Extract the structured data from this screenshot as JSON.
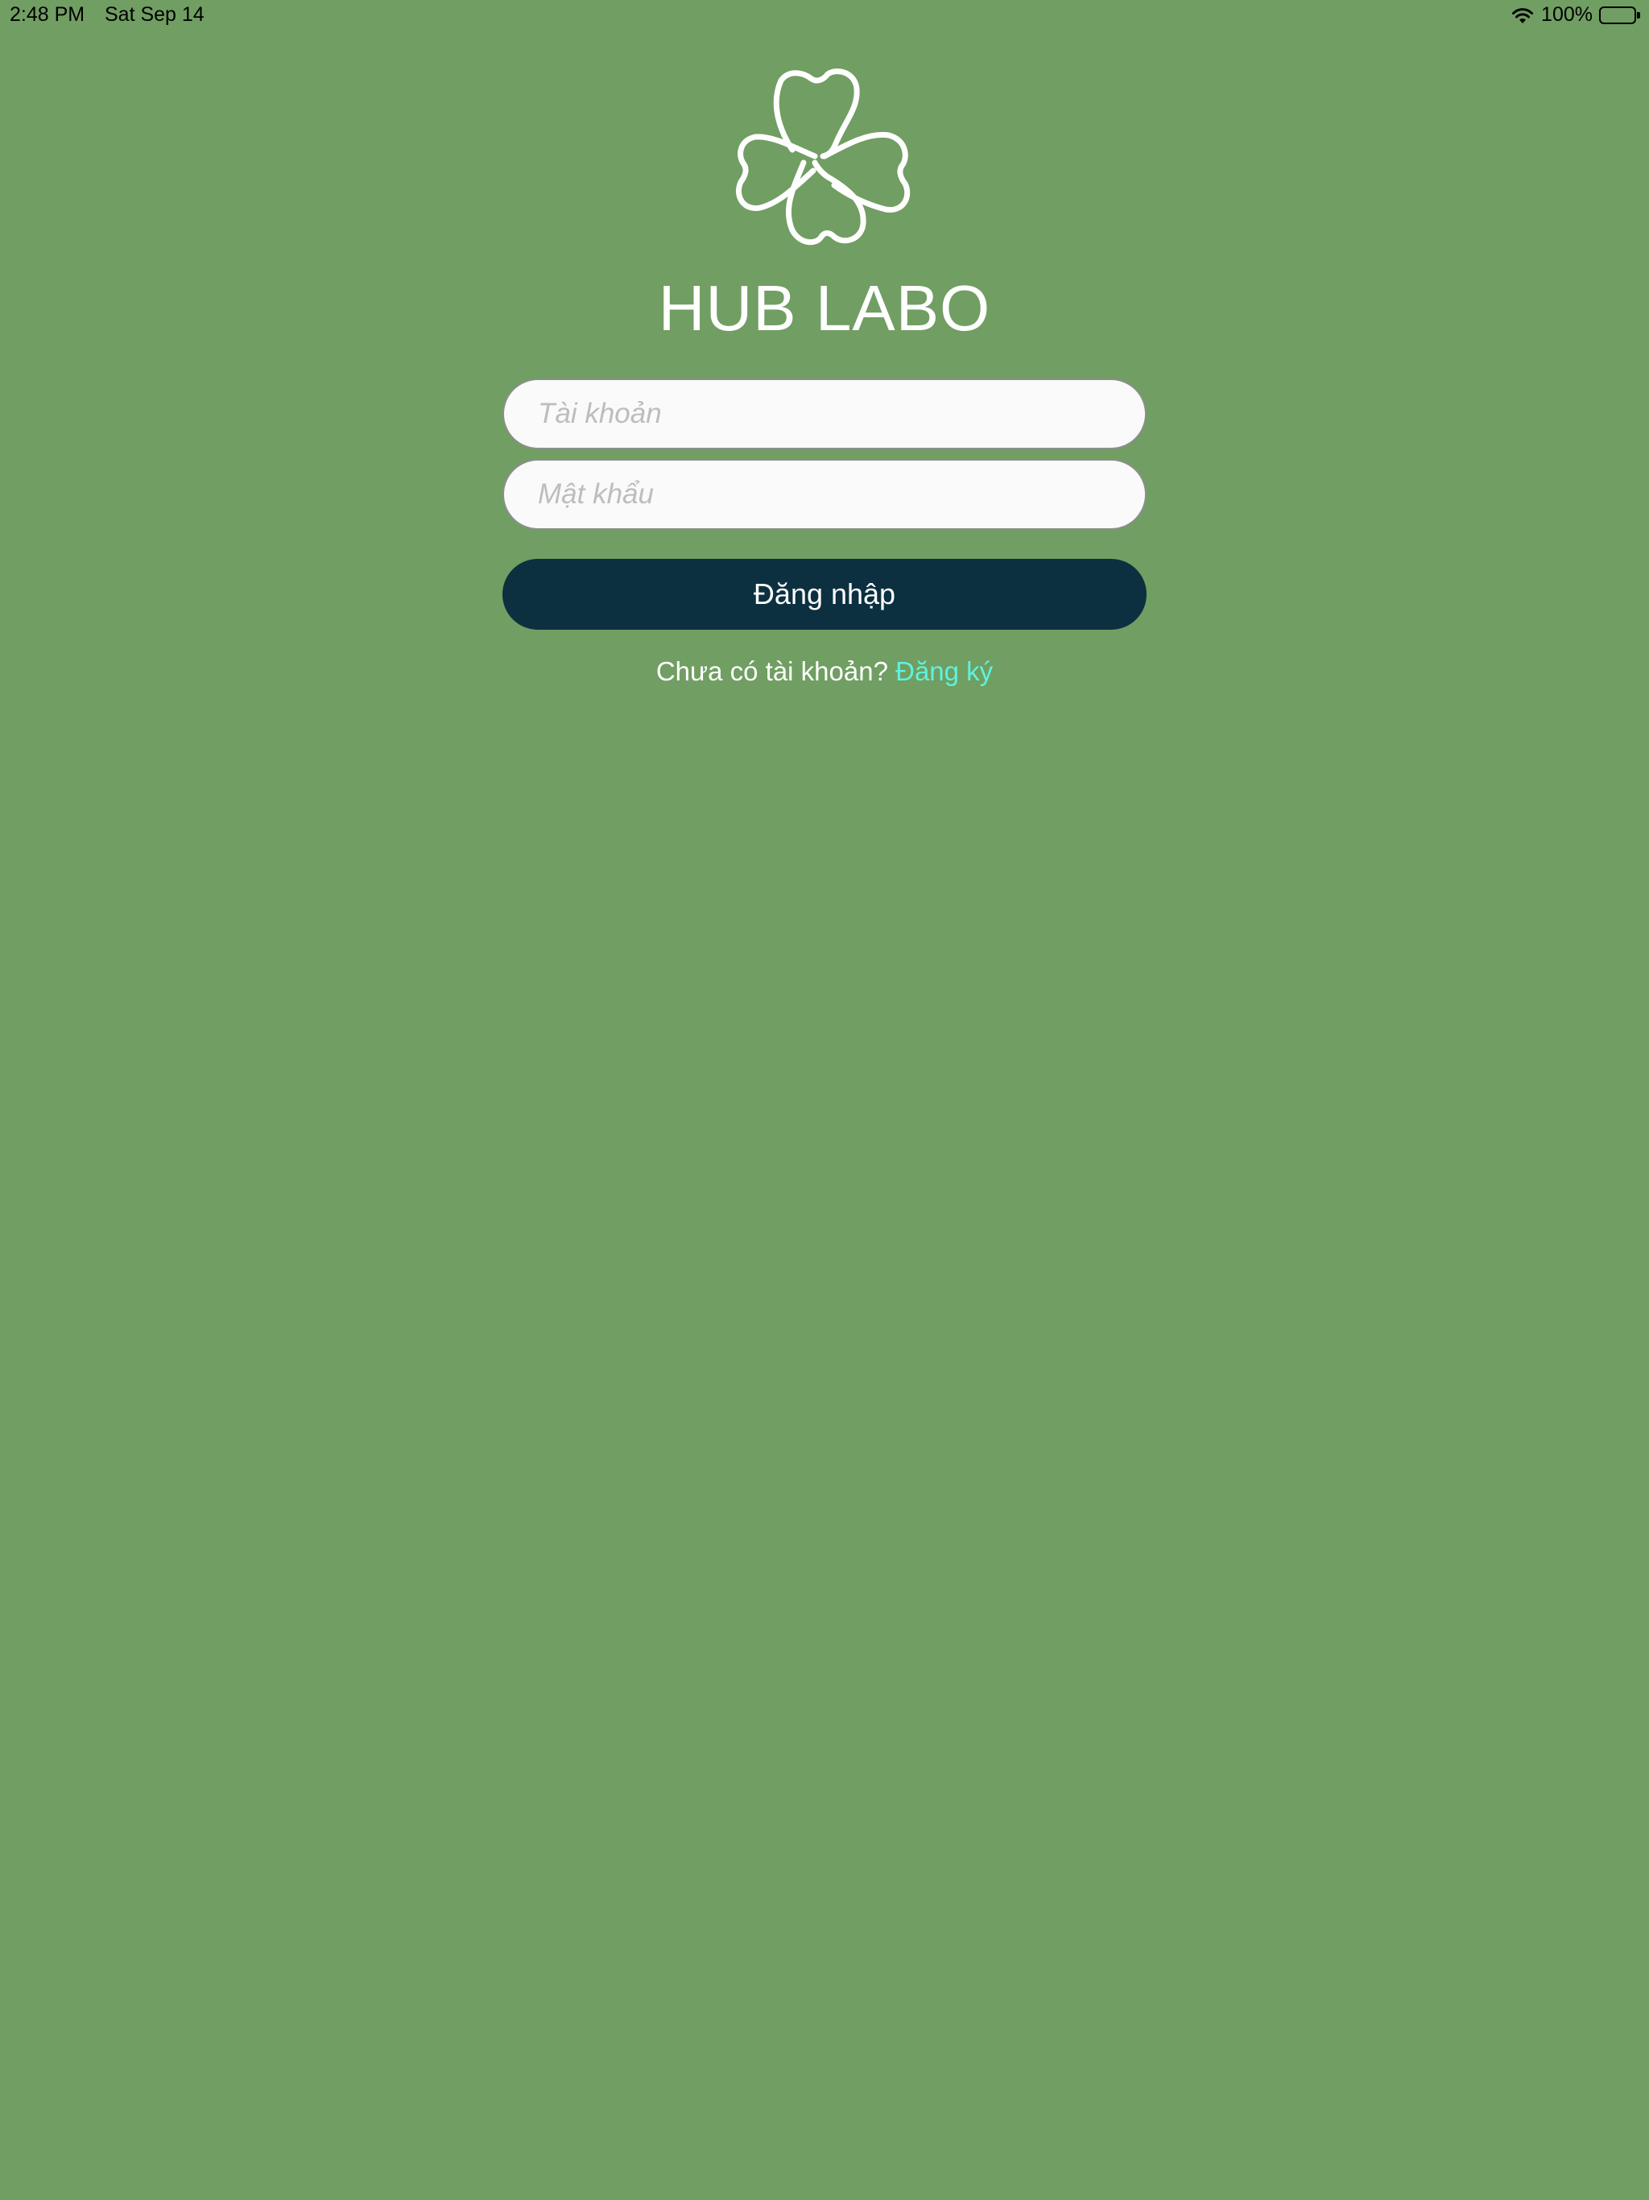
{
  "status_bar": {
    "time": "2:48 PM",
    "date": "Sat Sep 14",
    "battery_percent": "100%",
    "battery_level": 1.0,
    "icons": [
      "wifi-icon",
      "battery-icon"
    ]
  },
  "brand": {
    "logo_icon": "tooth-clover-logo-icon",
    "name": "HUB LABO"
  },
  "login_form": {
    "username_placeholder": "Tài khoản",
    "username_value": "",
    "password_placeholder": "Mật khẩu",
    "password_value": "",
    "submit_label": "Đăng nhập"
  },
  "signup": {
    "prompt": "Chưa có tài khoản? ",
    "link_label": "Đăng ký"
  },
  "colors": {
    "background": "#719e62",
    "button": "#0c3040",
    "link": "#5ef2df",
    "input_background": "#fafafa"
  }
}
